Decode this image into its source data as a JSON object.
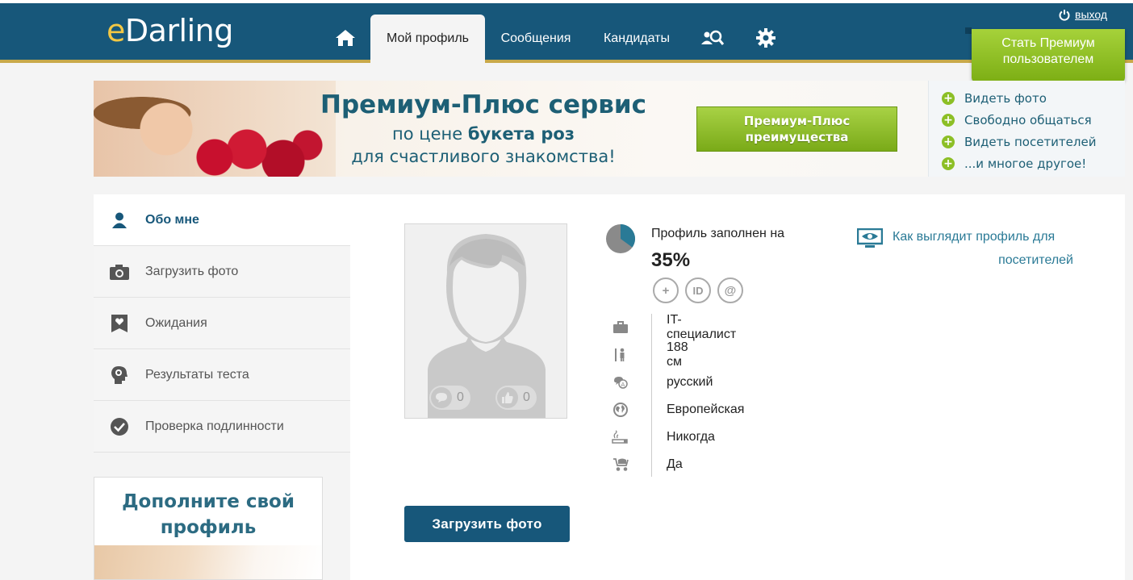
{
  "header": {
    "logo_e": "e",
    "logo_rest": "Darling",
    "tabs": [
      {
        "label": "Мой профиль"
      },
      {
        "label": "Сообщения"
      },
      {
        "label": "Кандидаты"
      }
    ],
    "logout_label": "выход",
    "premium_line1": "Стать Премиум",
    "premium_line2": "пользователем"
  },
  "banner": {
    "title": "Премиум-Плюс сервис",
    "sub1_prefix": "по цене ",
    "sub1_bold": "букета роз",
    "sub2": "для счастливого знакомства!",
    "cta_line1": "Премиум-Плюс",
    "cta_line2": "преимущества",
    "features": [
      "Видеть фото",
      "Свободно общаться",
      "Видеть посетителей",
      "...и многое другое!"
    ]
  },
  "sidebar": {
    "items": [
      {
        "label": "Обо мне"
      },
      {
        "label": "Загрузить фото"
      },
      {
        "label": "Ожидания"
      },
      {
        "label": "Результаты теста"
      },
      {
        "label": "Проверка подлинности"
      }
    ],
    "promo_line1": "Дополните свой",
    "promo_line2": "профиль"
  },
  "profile": {
    "messages_count": "0",
    "likes_count": "0",
    "completion_label": "Профиль заполнен на",
    "completion_value": "35%",
    "completion_fraction": 0.35,
    "badges": [
      "+",
      "ID",
      "@"
    ],
    "preview_line1": "Как выглядит профиль для",
    "preview_line2": "посетителей",
    "facts": [
      {
        "icon": "briefcase-icon",
        "text": "IT-специалист"
      },
      {
        "icon": "height-icon",
        "text": "188 см"
      },
      {
        "icon": "language-icon",
        "text": "русский"
      },
      {
        "icon": "globe-icon",
        "text": "Европейская"
      },
      {
        "icon": "smoking-icon",
        "text": "Никогда"
      },
      {
        "icon": "stroller-icon",
        "text": "Да"
      }
    ],
    "upload_button": "Загрузить фото"
  },
  "colors": {
    "header_bg": "#17577a",
    "accent_green": "#8cbf26",
    "link_blue": "#2a7a96"
  }
}
